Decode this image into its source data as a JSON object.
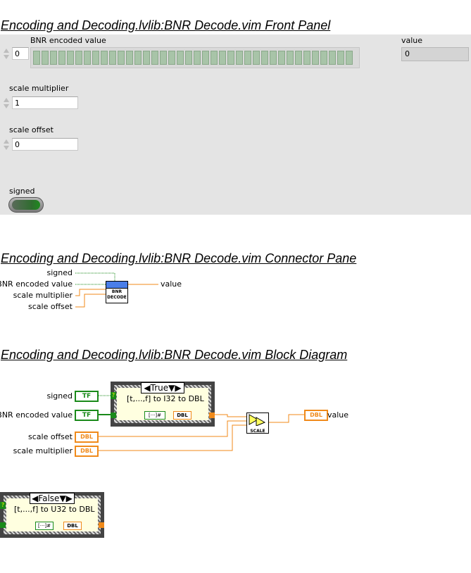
{
  "front_panel": {
    "title": "Encoding and Decoding.lvlib:BNR Decode.vim Front Panel",
    "bnr_label": "BNR encoded value",
    "bnr_value": "0",
    "value_label": "value",
    "value_value": "0",
    "scale_multiplier_label": "scale multiplier",
    "scale_multiplier_value": "1",
    "scale_offset_label": "scale offset",
    "scale_offset_value": "0",
    "signed_label": "signed"
  },
  "connector_pane": {
    "title": "Encoding and Decoding.lvlib:BNR Decode.vim Connector Pane",
    "inputs": [
      "signed",
      "BNR encoded value",
      "scale multiplier",
      "scale offset"
    ],
    "output": "value",
    "icon_line1": "BNR",
    "icon_line2": "DECODE"
  },
  "block_diagram": {
    "title": "Encoding and Decoding.lvlib:BNR Decode.vim Block Diagram",
    "signed_label": "signed",
    "bnr_label": "BNR encoded value",
    "scale_offset_label": "scale offset",
    "scale_multiplier_label": "scale multiplier",
    "value_label": "value",
    "tf": "TF",
    "dbl": "DBL",
    "case_true": {
      "selector": "True",
      "text": "[t,...,f] to I32 to DBL"
    },
    "case_false": {
      "selector": "False",
      "text": "[t,...,f] to U32 to DBL"
    },
    "scale_label": "SCALE",
    "question": "?",
    "array_to_num": "[···]#"
  },
  "colors": {
    "boolean_wire": "#1a8a1a",
    "double_wire": "#f08a1a",
    "integer_wire": "#1e4fd8"
  }
}
